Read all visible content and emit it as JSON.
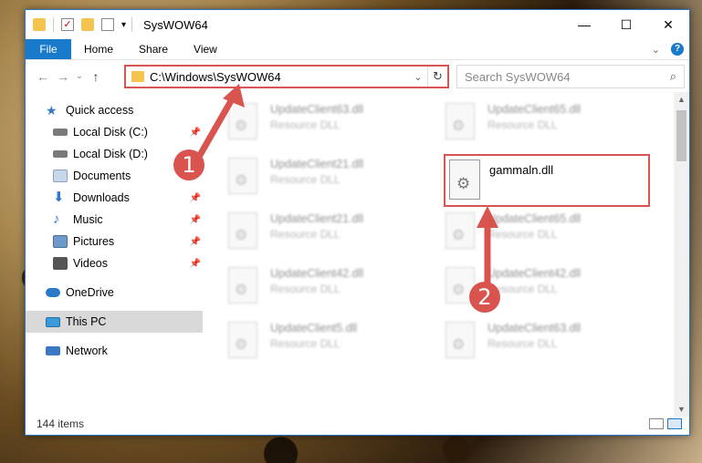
{
  "window": {
    "title": "SysWOW64",
    "controls": {
      "minimize": "—",
      "maximize": "☐",
      "close": "✕"
    }
  },
  "ribbon": {
    "tabs": [
      "File",
      "Home",
      "Share",
      "View"
    ]
  },
  "navigation": {
    "back": "←",
    "forward": "→",
    "recent": "⌄",
    "up": "↑",
    "address": "C:\\Windows\\SysWOW64",
    "refresh": "↻",
    "search_placeholder": "Search SysWOW64"
  },
  "sidebar": {
    "items": [
      {
        "label": "Quick access",
        "icon": "star-icon",
        "color": "#3b78c4"
      },
      {
        "label": "Local Disk (C:)",
        "icon": "drive-icon",
        "color": "#7a7a7a"
      },
      {
        "label": "Local Disk (D:)",
        "icon": "drive-icon",
        "color": "#7a7a7a"
      },
      {
        "label": "Documents",
        "icon": "documents-icon",
        "color": "#c8d6ea"
      },
      {
        "label": "Downloads",
        "icon": "download-icon",
        "color": "#2b79c9"
      },
      {
        "label": "Music",
        "icon": "music-icon",
        "color": "#2b79c9"
      },
      {
        "label": "Pictures",
        "icon": "pictures-icon",
        "color": "#6d9ac9"
      },
      {
        "label": "Videos",
        "icon": "videos-icon",
        "color": "#555555"
      },
      {
        "label": "OneDrive",
        "icon": "cloud-icon",
        "color": "#2b79c9"
      },
      {
        "label": "This PC",
        "icon": "computer-icon",
        "color": "#3b9bd9"
      },
      {
        "label": "Network",
        "icon": "network-icon",
        "color": "#3b78c4"
      }
    ]
  },
  "files": [
    {
      "name": "UpdateClient63.dll",
      "type": "Resource DLL"
    },
    {
      "name": "UpdateClient65.dll",
      "type": "Resource DLL"
    },
    {
      "name": "UpdateClient21.dll",
      "type": "Resource DLL"
    },
    {
      "name": "UpdateClient21.dll",
      "type": "Resource DLL"
    },
    {
      "name": "UpdateClient65.dll",
      "type": "Resource DLL"
    },
    {
      "name": "UpdateClient42.dll",
      "type": "Resource DLL"
    },
    {
      "name": "UpdateClient42.dll",
      "type": "Resource DLL"
    },
    {
      "name": "UpdateClient5.dll",
      "type": "Resource DLL"
    },
    {
      "name": "UpdateClient63.dll",
      "type": "Resource DLL"
    }
  ],
  "highlighted_file": {
    "name": "gammaln.dll"
  },
  "status": {
    "item_count": "144 items"
  },
  "callouts": {
    "step1": "1",
    "step2": "2"
  },
  "colors": {
    "accent": "#1979ca",
    "highlight": "#d9534f"
  }
}
